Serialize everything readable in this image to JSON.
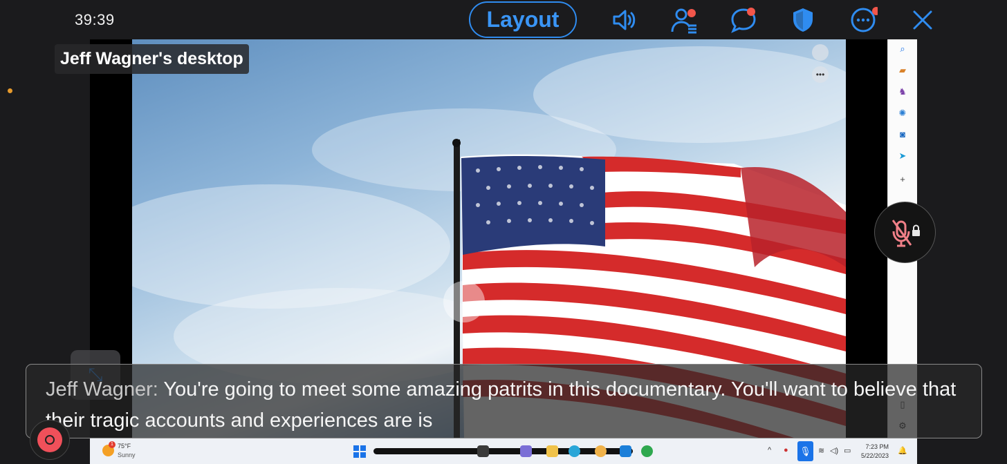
{
  "topbar": {
    "timer": "39:39",
    "layout_label": "Layout",
    "accent_color": "#2f8cf0",
    "notification_dot_color": "#f2564b",
    "icons": [
      "speaker-icon",
      "participants-icon",
      "chat-icon",
      "security-shield-icon",
      "more-icon",
      "close-icon"
    ]
  },
  "share": {
    "sharer_label": "Jeff Wagner's desktop"
  },
  "caption": {
    "speaker": "Jeff Wagner:",
    "text": " You're going to meet some amazing patrits in this documentary. You'll want to believe that their tragic accounts and experiences are is"
  },
  "taskbar": {
    "temperature": "75°F",
    "condition": "Sunny",
    "weather_badge": "1",
    "time": "7:23 PM",
    "date": "5/22/2023"
  },
  "edge_sidebar": {
    "icons": [
      "search-icon",
      "briefcase-icon",
      "games-icon",
      "copilot-icon",
      "outlook-icon",
      "send-icon",
      "add-icon",
      "sidebar-toggle-icon",
      "settings-icon"
    ]
  }
}
